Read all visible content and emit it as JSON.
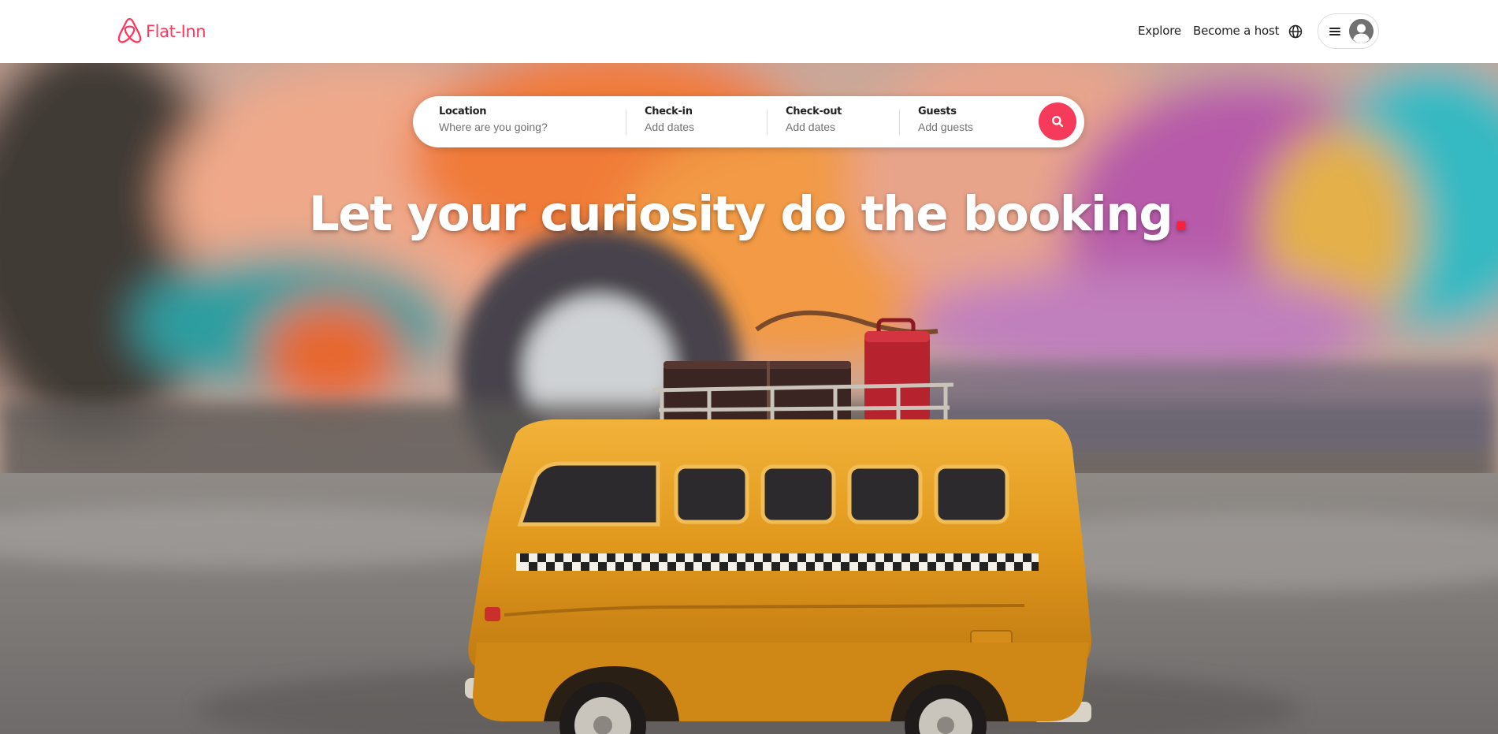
{
  "header": {
    "brand": "Flat-Inn",
    "logo_icon": "airbnb-belo-icon",
    "nav_explore": "Explore",
    "nav_host": "Become a host",
    "globe_icon": "globe-icon",
    "menu_icon": "hamburger-menu-icon",
    "avatar_icon": "user-avatar-icon"
  },
  "search": {
    "location_label": "Location",
    "location_placeholder": "Where are you going?",
    "checkin_label": "Check-in",
    "checkin_placeholder": "Add dates",
    "checkout_label": "Check-out",
    "checkout_placeholder": "Add dates",
    "guests_label": "Guests",
    "guests_placeholder": "Add guests",
    "search_icon": "search-icon"
  },
  "hero": {
    "headline": "Let your curiosity do the booking",
    "headline_dot": ".",
    "image": "yellow toy bus with luggage on roof"
  },
  "colors": {
    "brand": "#ff385c",
    "search_button": "#f63a5c",
    "headline_dot": "#ff1f3a"
  }
}
